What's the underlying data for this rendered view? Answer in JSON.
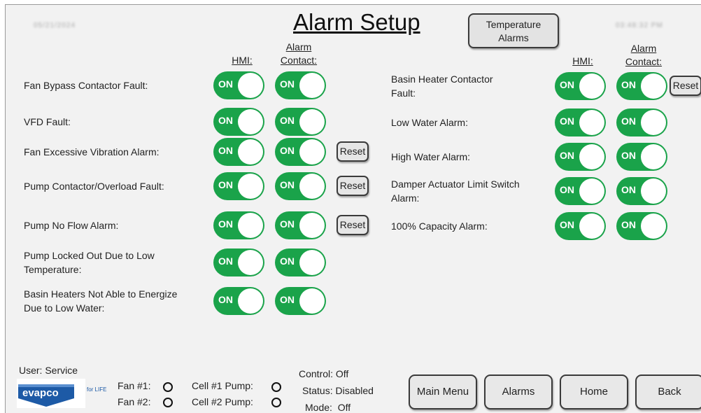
{
  "header": {
    "date": "05/21/2024",
    "time": "03:48:32 PM",
    "title": "Alarm Setup",
    "temperature_button": [
      "Temperature",
      "Alarms"
    ]
  },
  "columns": {
    "hmi": "HMI:",
    "alarm_contact": [
      "Alarm",
      "Contact:"
    ]
  },
  "toggle_label": "ON",
  "reset_label": "Reset",
  "left_alarms": [
    {
      "label": [
        "Fan Bypass Contactor Fault:"
      ],
      "hmi": "ON",
      "contact": "ON",
      "reset": false
    },
    {
      "label": [
        "VFD Fault:"
      ],
      "hmi": "ON",
      "contact": "ON",
      "reset": false
    },
    {
      "label": [
        "Fan Excessive Vibration Alarm:"
      ],
      "hmi": "ON",
      "contact": "ON",
      "reset": true
    },
    {
      "label": [
        "Pump Contactor/Overload Fault:"
      ],
      "hmi": "ON",
      "contact": "ON",
      "reset": true
    },
    {
      "label": [
        "Pump No Flow Alarm:"
      ],
      "hmi": "ON",
      "contact": "ON",
      "reset": true
    },
    {
      "label": [
        "Pump Locked Out Due to Low",
        "Temperature:"
      ],
      "hmi": "ON",
      "contact": "ON",
      "reset": false
    },
    {
      "label": [
        "Basin Heaters Not Able to Energize",
        "Due to Low Water:"
      ],
      "hmi": "ON",
      "contact": "ON",
      "reset": false
    }
  ],
  "right_alarms": [
    {
      "label": [
        "Basin Heater Contactor",
        "Fault:"
      ],
      "hmi": "ON",
      "contact": "ON",
      "reset": true
    },
    {
      "label": [
        "Low Water Alarm:"
      ],
      "hmi": "ON",
      "contact": "ON",
      "reset": false
    },
    {
      "label": [
        "High Water Alarm:"
      ],
      "hmi": "ON",
      "contact": "ON",
      "reset": false
    },
    {
      "label": [
        "Damper Actuator Limit Switch",
        "Alarm:"
      ],
      "hmi": "ON",
      "contact": "ON",
      "reset": false
    },
    {
      "label": [
        "100% Capacity Alarm:"
      ],
      "hmi": "ON",
      "contact": "ON",
      "reset": false
    }
  ],
  "footer": {
    "user": "User: Service",
    "logo_text": "evapco",
    "logo_tag": "for LIFE",
    "fan1": "Fan #1:",
    "fan2": "Fan #2:",
    "cell1_pump": "Cell #1 Pump:",
    "cell2_pump": "Cell #2 Pump:",
    "control": "Control: Off",
    "status": "Status: Disabled",
    "mode": "Mode:  Off"
  },
  "nav": [
    "Main Menu",
    "Alarms",
    "Home",
    "Back"
  ],
  "colors": {
    "toggle_on": "#1aa34a",
    "panel_bg": "#f2f2f2",
    "logo_blue": "#1d5aa6"
  }
}
